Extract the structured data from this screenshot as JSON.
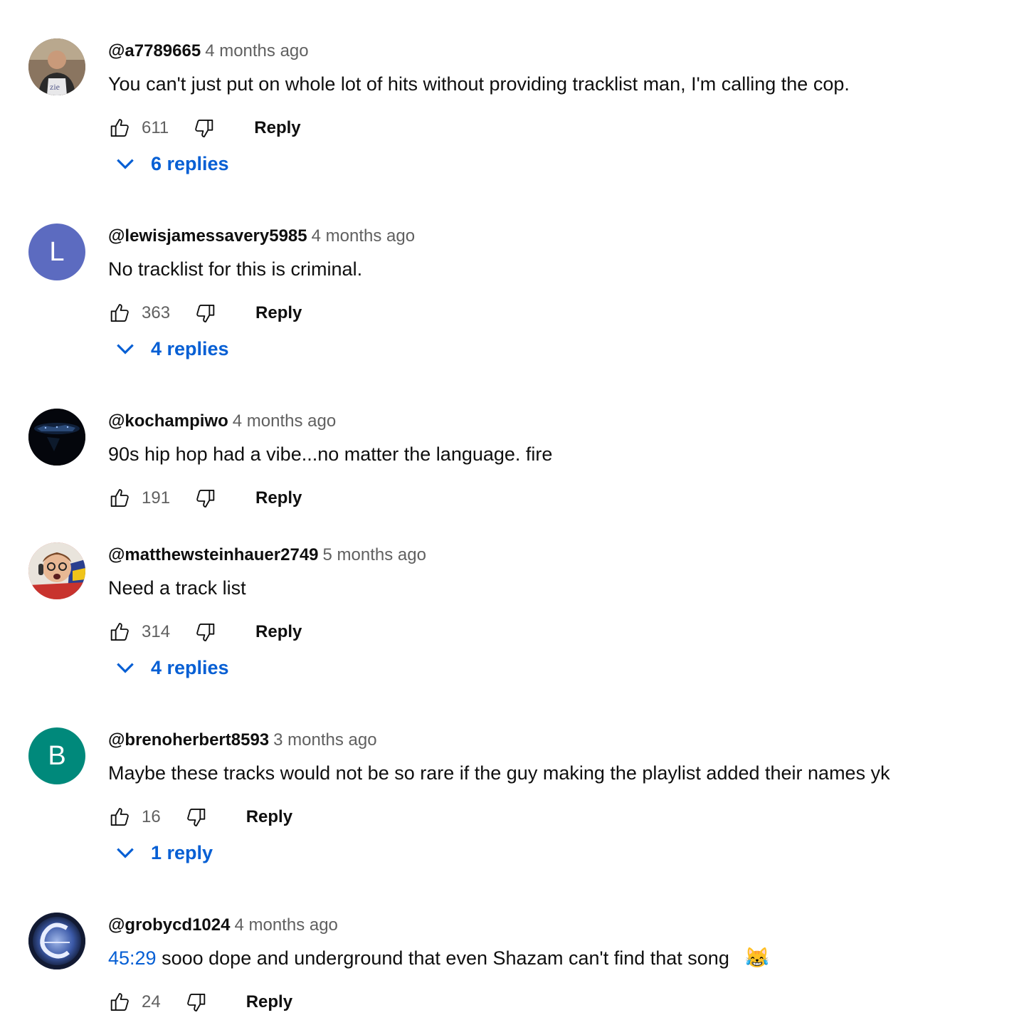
{
  "comments": [
    {
      "author": "@a7789665",
      "time": "4 months ago",
      "text": "You can't just put on whole lot of hits without providing tracklist man, I'm calling the cop.",
      "likes": "611",
      "reply_label": "Reply",
      "replies_label": "6 replies",
      "avatar_type": "photo-person-shirt"
    },
    {
      "author": "@lewisjamessavery5985",
      "time": "4 months ago",
      "text": "No tracklist for this is criminal.",
      "likes": "363",
      "reply_label": "Reply",
      "replies_label": "4 replies",
      "avatar_letter": "L",
      "avatar_color": "#5c6bc0"
    },
    {
      "author": "@kochampiwo",
      "time": "4 months ago",
      "text": "90s hip hop had a vibe...no matter the language. fire",
      "likes": "191",
      "reply_label": "Reply",
      "avatar_type": "photo-night-city"
    },
    {
      "author": "@matthewsteinhauer2749",
      "time": "5 months ago",
      "text": "Need a track list",
      "likes": "314",
      "reply_label": "Reply",
      "replies_label": "4 replies",
      "avatar_type": "photo-face-headphones"
    },
    {
      "author": "@brenoherbert8593",
      "time": "3 months ago",
      "text": "Maybe these tracks would not be so rare if the guy making the playlist added their names yk",
      "likes": "16",
      "reply_label": "Reply",
      "replies_label": "1 reply",
      "avatar_letter": "B",
      "avatar_color": "#00897b"
    },
    {
      "author": "@grobycd1024",
      "time": "4 months ago",
      "timestamp_link": "45:29",
      "text": "sooo dope and underground that even Shazam can't find that song",
      "emoji": "😹",
      "likes": "24",
      "reply_label": "Reply",
      "avatar_type": "logo-letter-c"
    }
  ],
  "colors": {
    "link": "#065fd4",
    "secondary_text": "#606060",
    "primary_text": "#0f0f0f"
  },
  "icons": [
    "thumb-up-icon",
    "thumb-down-icon",
    "chevron-down-icon"
  ]
}
